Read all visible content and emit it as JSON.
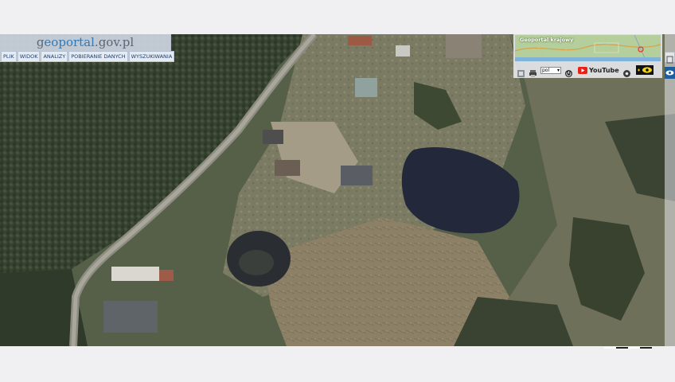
{
  "header": {
    "logo_parts": [
      "g",
      "eo",
      "portal",
      ".gov.pl"
    ],
    "menu": [
      {
        "label": "PLIK"
      },
      {
        "label": "WIDOK"
      },
      {
        "label": "ANALIZY"
      },
      {
        "label": "POBIERANIE DANYCH"
      },
      {
        "label": "WYSZUKIWANIA"
      }
    ]
  },
  "overview": {
    "title": "Geoportal krajowy"
  },
  "toolbar": {
    "icons": [
      "layers-icon",
      "print-icon"
    ],
    "language": "pol",
    "youtube_label": "YouTube",
    "help_icon": "settings-icon",
    "eye_toggle_icon": "eye-icon"
  },
  "side_strip": {
    "expand_icon": "expand-icon",
    "eye_icon": "eye-icon"
  },
  "colors": {
    "header_bg": "#cdd6e2",
    "menu_text": "#1b3f73",
    "portal_blue": "#2f79b8",
    "youtube_red": "#e62117",
    "eye_yellow": "#f2d21b"
  }
}
